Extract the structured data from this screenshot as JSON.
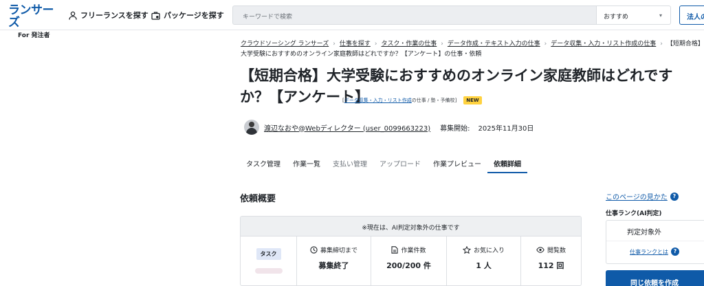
{
  "header": {
    "logo_main": "ランサーズ",
    "logo_sub": "For 発注者",
    "nav_freelance": "フリーランスを探す",
    "nav_package": "パッケージを探す",
    "search_placeholder": "キーワードで検索",
    "sort_value": "おすすめ",
    "corp_button": "法人の"
  },
  "breadcrumb": [
    "クラウドソーシング ランサーズ",
    "仕事を探す",
    "タスク・作業の仕事",
    "データ作成・テキスト入力の仕事",
    "データ収集・入力・リスト作成の仕事",
    "【短期合格】大学受験におすすめのオンライン家庭教師はどれですか？【アンケート】の仕事・依頼"
  ],
  "job": {
    "title": "【短期合格】大学受験におすすめのオンライン家庭教師はどれですか？【アンケート】",
    "category_prefix": "[",
    "category_link": "データ収集・入力・リスト作成",
    "category_suffix": "の仕事 / 塾・予備校]",
    "new_badge": "NEW",
    "client_name": "渡辺なおや@Webディレクター (user_0099663223)",
    "posted_label": "募集開始:",
    "posted_date": "2025年11月30日"
  },
  "tabs": [
    {
      "label": "タスク管理",
      "state": "normal"
    },
    {
      "label": "作業一覧",
      "state": "normal"
    },
    {
      "label": "支払い管理",
      "state": "muted"
    },
    {
      "label": "アップロード",
      "state": "muted"
    },
    {
      "label": "作業プレビュー",
      "state": "normal"
    },
    {
      "label": "依頼詳細",
      "state": "active"
    }
  ],
  "overview": {
    "title": "依頼概要",
    "notice": "※現在は、AI判定対象外の仕事です",
    "type_badge": "タスク",
    "stats": [
      {
        "icon": "clock-icon",
        "label": "募集締切まで",
        "value": "募集終了"
      },
      {
        "icon": "document-icon",
        "label": "作業件数",
        "value": "200/200 件"
      },
      {
        "icon": "star-icon",
        "label": "お気に入り",
        "value": "1 人"
      },
      {
        "icon": "eye-icon",
        "label": "閲覧数",
        "value": "112 回"
      }
    ]
  },
  "sidebar": {
    "help_link": "このページの見かた",
    "rank_label": "仕事ランク(AI判定)",
    "rank_value": "判定対象外",
    "rank_link": "仕事ランクとは",
    "same_request_button": "同じ依頼を作成"
  },
  "colors": {
    "brand": "#0f5aa8",
    "new_badge": "#ffd23f"
  }
}
